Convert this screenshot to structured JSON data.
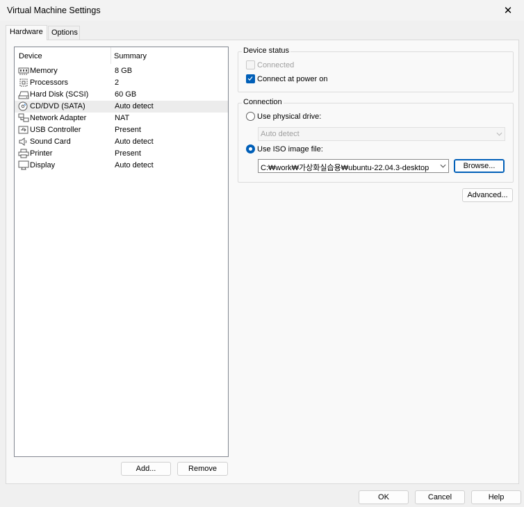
{
  "window": {
    "title": "Virtual Machine Settings",
    "close_glyph": "✕"
  },
  "tabs": [
    {
      "label": "Hardware",
      "active": true
    },
    {
      "label": "Options",
      "active": false
    }
  ],
  "device_list": {
    "columns": [
      "Device",
      "Summary"
    ],
    "rows": [
      {
        "name": "Memory",
        "summary": "8 GB",
        "icon": "memory-icon"
      },
      {
        "name": "Processors",
        "summary": "2",
        "icon": "processor-icon"
      },
      {
        "name": "Hard Disk (SCSI)",
        "summary": "60 GB",
        "icon": "hard-disk-icon"
      },
      {
        "name": "CD/DVD (SATA)",
        "summary": "Auto detect",
        "icon": "cd-dvd-icon",
        "selected": true
      },
      {
        "name": "Network Adapter",
        "summary": "NAT",
        "icon": "network-adapter-icon"
      },
      {
        "name": "USB Controller",
        "summary": "Present",
        "icon": "usb-icon"
      },
      {
        "name": "Sound Card",
        "summary": "Auto detect",
        "icon": "speaker-icon"
      },
      {
        "name": "Printer",
        "summary": "Present",
        "icon": "printer-icon"
      },
      {
        "name": "Display",
        "summary": "Auto detect",
        "icon": "monitor-icon"
      }
    ],
    "add_label": "Add...",
    "remove_label": "Remove"
  },
  "device_status": {
    "title": "Device status",
    "connected_label": "Connected",
    "connected_checked": false,
    "connected_enabled": false,
    "power_on_label": "Connect at power on",
    "power_on_checked": true
  },
  "connection": {
    "title": "Connection",
    "physical_label": "Use physical drive:",
    "physical_value": "Auto detect",
    "iso_label": "Use ISO image file:",
    "iso_value": "C:₩work₩가상화실습용₩ubuntu-22.04.3-desktop",
    "browse_label": "Browse...",
    "selected": "iso"
  },
  "advanced_label": "Advanced...",
  "footer": {
    "ok_label": "OK",
    "cancel_label": "Cancel",
    "help_label": "Help"
  },
  "colors": {
    "accent": "#005fb8",
    "background": "#f0f0f0",
    "panel": "#f9f9f9"
  }
}
